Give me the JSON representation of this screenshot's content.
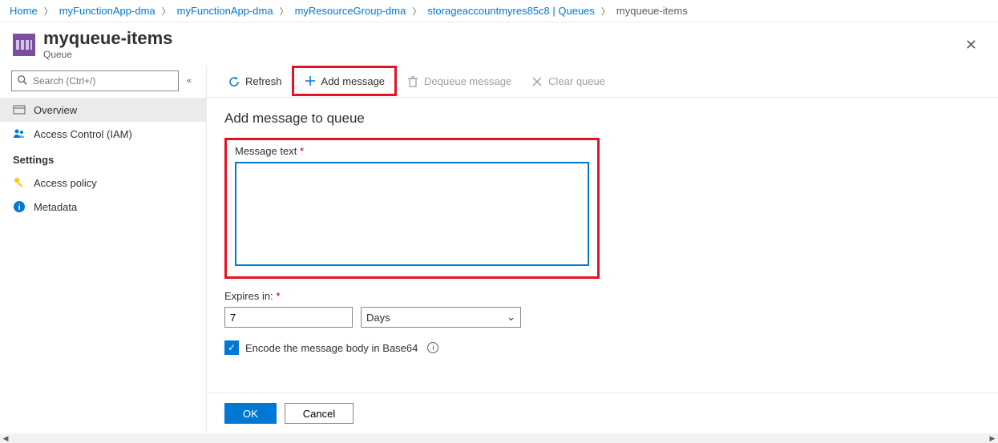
{
  "breadcrumb": {
    "items": [
      {
        "label": "Home"
      },
      {
        "label": "myFunctionApp-dma"
      },
      {
        "label": "myFunctionApp-dma"
      },
      {
        "label": "myResourceGroup-dma"
      },
      {
        "label": "storageaccountmyres85c8 | Queues"
      }
    ],
    "current": "myqueue-items"
  },
  "header": {
    "title": "myqueue-items",
    "subtitle": "Queue"
  },
  "sidebar": {
    "search_placeholder": "Search (Ctrl+/)",
    "items": [
      {
        "label": "Overview",
        "icon": "overview-icon",
        "active": true
      },
      {
        "label": "Access Control (IAM)",
        "icon": "iam-icon",
        "active": false
      }
    ],
    "settings_header": "Settings",
    "settings_items": [
      {
        "label": "Access policy",
        "icon": "key-icon"
      },
      {
        "label": "Metadata",
        "icon": "info-icon"
      }
    ]
  },
  "toolbar": {
    "refresh": "Refresh",
    "add_message": "Add message",
    "dequeue_message": "Dequeue message",
    "clear_queue": "Clear queue"
  },
  "form": {
    "title": "Add message to queue",
    "message_label": "Message text",
    "message_value": "",
    "expires_label": "Expires in:",
    "expires_value": "7",
    "expires_unit": "Days",
    "encode_label": "Encode the message body in Base64",
    "encode_checked": true
  },
  "footer": {
    "ok": "OK",
    "cancel": "Cancel"
  }
}
